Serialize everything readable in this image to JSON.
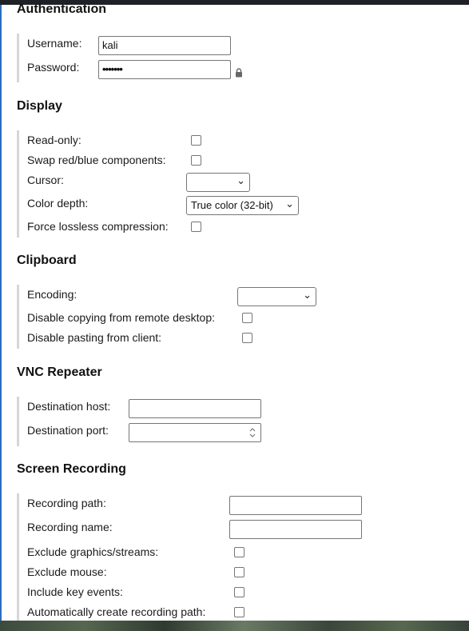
{
  "authentication": {
    "title": "Authentication",
    "username_label": "Username:",
    "username_value": "kali",
    "password_label": "Password:",
    "password_masked": "•••••••"
  },
  "display": {
    "title": "Display",
    "read_only_label": "Read-only:",
    "swap_label": "Swap red/blue components:",
    "cursor_label": "Cursor:",
    "cursor_value": "",
    "color_depth_label": "Color depth:",
    "color_depth_value": "True color (32-bit)",
    "lossless_label": "Force lossless compression:"
  },
  "clipboard": {
    "title": "Clipboard",
    "encoding_label": "Encoding:",
    "encoding_value": "",
    "disable_copy_label": "Disable copying from remote desktop:",
    "disable_paste_label": "Disable pasting from client:"
  },
  "vnc_repeater": {
    "title": "VNC Repeater",
    "dest_host_label": "Destination host:",
    "dest_port_label": "Destination port:"
  },
  "screen_recording": {
    "title": "Screen Recording",
    "path_label": "Recording path:",
    "name_label": "Recording name:",
    "exclude_graphics_label": "Exclude graphics/streams:",
    "exclude_mouse_label": "Exclude mouse:",
    "include_keys_label": "Include key events:",
    "auto_create_label": "Automatically create recording path:"
  },
  "icons": {
    "lock": "lock-icon",
    "chevron": "chevron-down-icon",
    "spinner": "spinner-arrows-icon"
  }
}
